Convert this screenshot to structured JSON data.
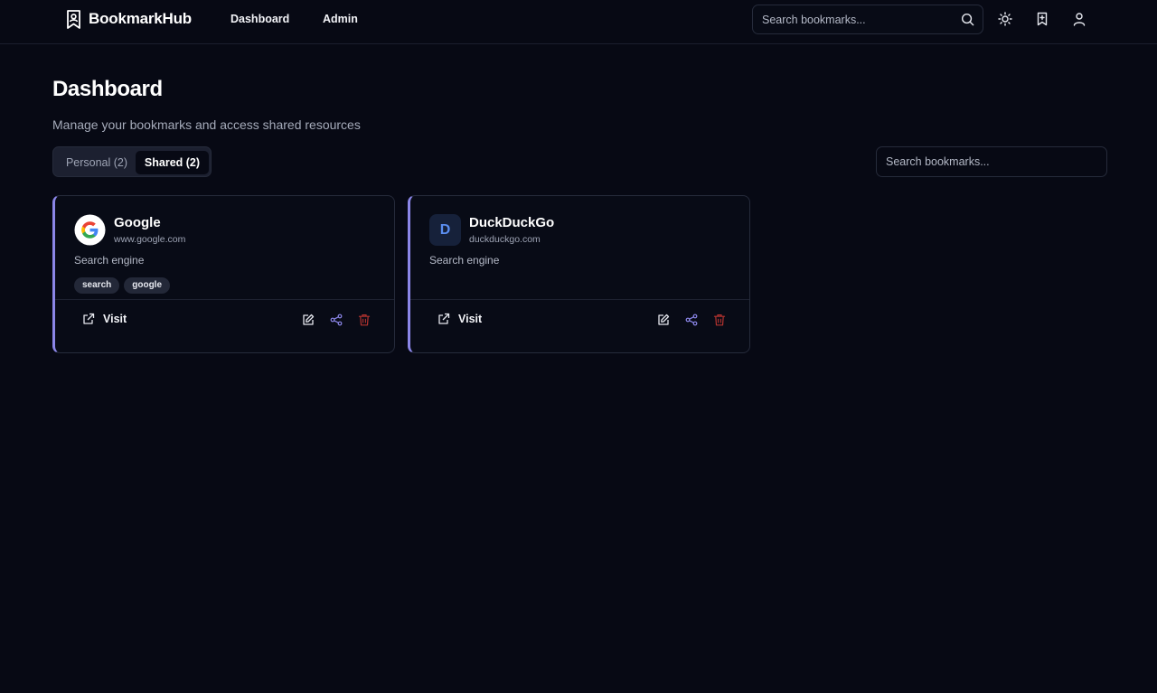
{
  "app": {
    "brand": "BookmarkHub",
    "nav": [
      {
        "label": "Dashboard"
      },
      {
        "label": "Admin"
      }
    ],
    "search_placeholder": "Search bookmarks...",
    "icons": [
      "search-icon",
      "sun-icon",
      "bookmark-icon",
      "user-icon"
    ]
  },
  "page": {
    "title": "Dashboard",
    "subtitle": "Manage your bookmarks and access shared resources",
    "tabs": [
      {
        "label": "Personal (2)",
        "active": false
      },
      {
        "label": "Shared (2)",
        "active": true
      }
    ],
    "filter_placeholder": "Search bookmarks..."
  },
  "bookmarks": [
    {
      "title": "Google",
      "domain": "www.google.com",
      "description": "Search engine",
      "tags": [
        "search",
        "google"
      ],
      "icon": "google-favicon",
      "visit_label": "Visit"
    },
    {
      "title": "DuckDuckGo",
      "domain": "duckduckgo.com",
      "description": "Search engine",
      "tags": [],
      "icon_letter": "D",
      "visit_label": "Visit"
    }
  ],
  "colors": {
    "background": "#070914",
    "accent": "#8b86e8",
    "share": "#8b86e8",
    "delete": "#b3332f",
    "letter_icon": "#5b8ef0"
  }
}
